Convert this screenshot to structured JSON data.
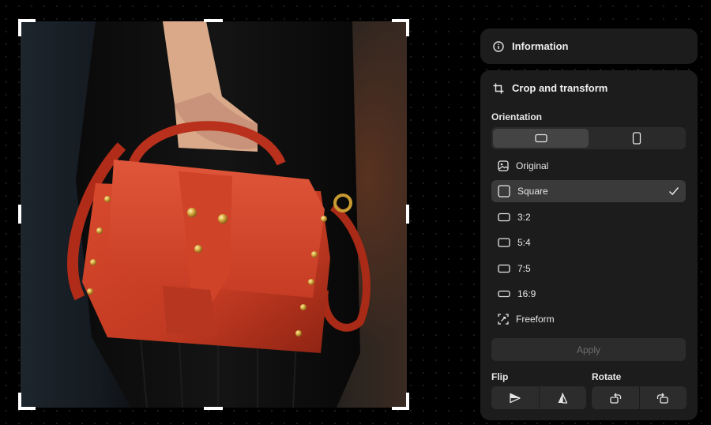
{
  "panel": {
    "information_label": "Information",
    "crop_title": "Crop and transform",
    "orientation_label": "Orientation",
    "orientation_options": [
      {
        "icon": "landscape-icon",
        "active": true
      },
      {
        "icon": "portrait-icon",
        "active": false
      }
    ],
    "ratios": [
      {
        "label": "Original",
        "icon": "image-icon",
        "selected": false
      },
      {
        "label": "Square",
        "icon": "square-icon",
        "selected": true
      },
      {
        "label": "3:2",
        "icon": "ratio-rect-icon",
        "selected": false
      },
      {
        "label": "5:4",
        "icon": "ratio-rect-icon",
        "selected": false
      },
      {
        "label": "7:5",
        "icon": "ratio-rect-icon",
        "selected": false
      },
      {
        "label": "16:9",
        "icon": "ratio-rect-icon",
        "selected": false
      },
      {
        "label": "Freeform",
        "icon": "freeform-icon",
        "selected": false
      }
    ],
    "apply_label": "Apply",
    "flip_label": "Flip",
    "rotate_label": "Rotate"
  },
  "image": {
    "subject": "red-leather-handbag-photo"
  }
}
